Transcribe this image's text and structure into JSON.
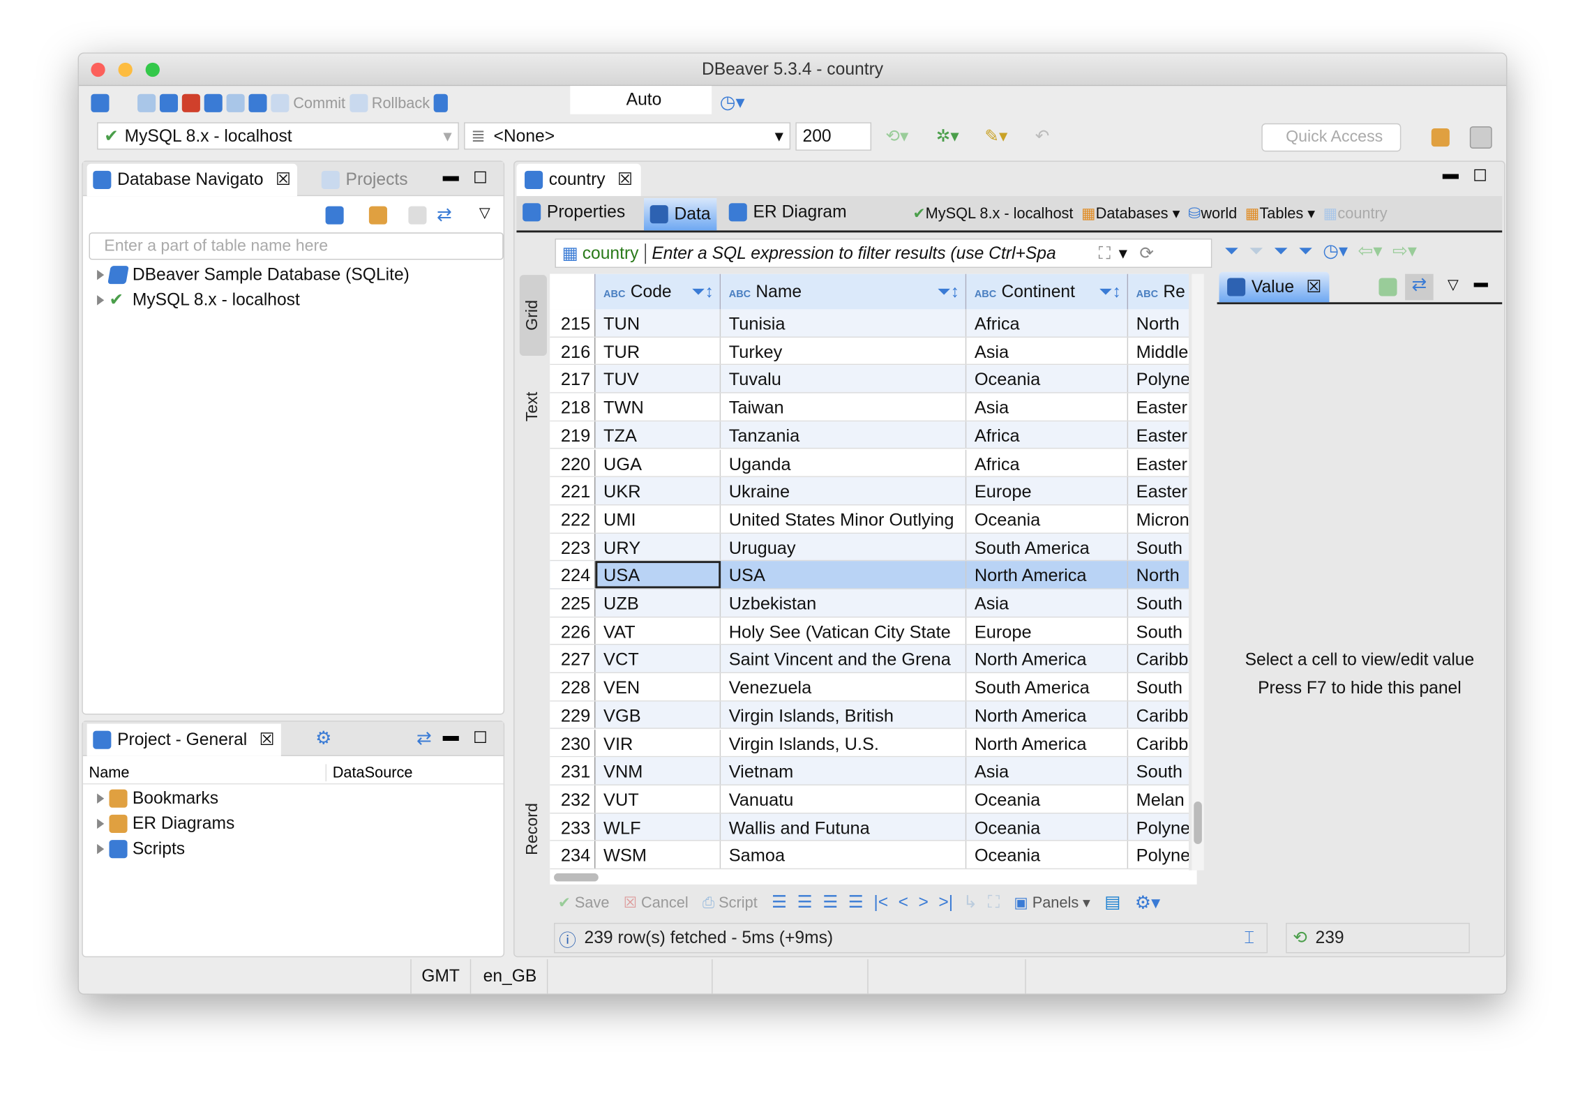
{
  "window": {
    "title": "DBeaver 5.3.4 - country"
  },
  "toolbar": {
    "commit": "Commit",
    "rollback": "Rollback",
    "transaction_mode": "Auto",
    "connection": "MySQL 8.x - localhost",
    "schema": "<None>",
    "limit": "200",
    "quick_access": "Quick Access"
  },
  "navigator": {
    "tab": "Database Navigato",
    "projects_tab": "Projects",
    "filter_placeholder": "Enter a part of table name here",
    "items": [
      {
        "label": "DBeaver Sample Database (SQLite)"
      },
      {
        "label": "MySQL 8.x - localhost"
      }
    ]
  },
  "project": {
    "tab": "Project - General",
    "col_name": "Name",
    "col_datasource": "DataSource",
    "items": [
      {
        "label": "Bookmarks"
      },
      {
        "label": "ER Diagrams"
      },
      {
        "label": "Scripts"
      }
    ]
  },
  "editor": {
    "tab": "country",
    "subtabs": [
      "Properties",
      "Data",
      "ER Diagram"
    ],
    "active_subtab": "Data",
    "breadcrumb": [
      "MySQL 8.x - localhost",
      "Databases",
      "world",
      "Tables",
      "country"
    ],
    "filter_table": "country",
    "filter_placeholder": "Enter a SQL expression to filter results (use Ctrl+Spa",
    "side_tabs": [
      "Grid",
      "Text",
      "Record"
    ],
    "columns": [
      "Code",
      "Name",
      "Continent",
      "Re"
    ],
    "rows": [
      [
        "215",
        "TUN",
        "Tunisia",
        "Africa",
        "North"
      ],
      [
        "216",
        "TUR",
        "Turkey",
        "Asia",
        "Middle"
      ],
      [
        "217",
        "TUV",
        "Tuvalu",
        "Oceania",
        "Polyne"
      ],
      [
        "218",
        "TWN",
        "Taiwan",
        "Asia",
        "Easter"
      ],
      [
        "219",
        "TZA",
        "Tanzania",
        "Africa",
        "Easter"
      ],
      [
        "220",
        "UGA",
        "Uganda",
        "Africa",
        "Easter"
      ],
      [
        "221",
        "UKR",
        "Ukraine",
        "Europe",
        "Easter"
      ],
      [
        "222",
        "UMI",
        "United States Minor Outlying",
        "Oceania",
        "Micron"
      ],
      [
        "223",
        "URY",
        "Uruguay",
        "South America",
        "South"
      ],
      [
        "224",
        "USA",
        "USA",
        "North America",
        "North"
      ],
      [
        "225",
        "UZB",
        "Uzbekistan",
        "Asia",
        "South"
      ],
      [
        "226",
        "VAT",
        "Holy See (Vatican City State",
        "Europe",
        "South"
      ],
      [
        "227",
        "VCT",
        "Saint Vincent and the Grena",
        "North America",
        "Caribb"
      ],
      [
        "228",
        "VEN",
        "Venezuela",
        "South America",
        "South"
      ],
      [
        "229",
        "VGB",
        "Virgin Islands, British",
        "North America",
        "Caribb"
      ],
      [
        "230",
        "VIR",
        "Virgin Islands, U.S.",
        "North America",
        "Caribb"
      ],
      [
        "231",
        "VNM",
        "Vietnam",
        "Asia",
        "South"
      ],
      [
        "232",
        "VUT",
        "Vanuatu",
        "Oceania",
        "Melan"
      ],
      [
        "233",
        "WLF",
        "Wallis and Futuna",
        "Oceania",
        "Polyne"
      ],
      [
        "234",
        "WSM",
        "Samoa",
        "Oceania",
        "Polyne"
      ]
    ],
    "selected_row": "224",
    "value_panel": {
      "tab": "Value",
      "line1": "Select a cell to view/edit value",
      "line2": "Press F7 to hide this panel"
    },
    "bottom": {
      "save": "Save",
      "cancel": "Cancel",
      "script": "Script",
      "panels": "Panels"
    },
    "status": "239 row(s) fetched - 5ms (+9ms)",
    "count": "239"
  },
  "statusbar": {
    "timezone": "GMT",
    "locale": "en_GB"
  }
}
